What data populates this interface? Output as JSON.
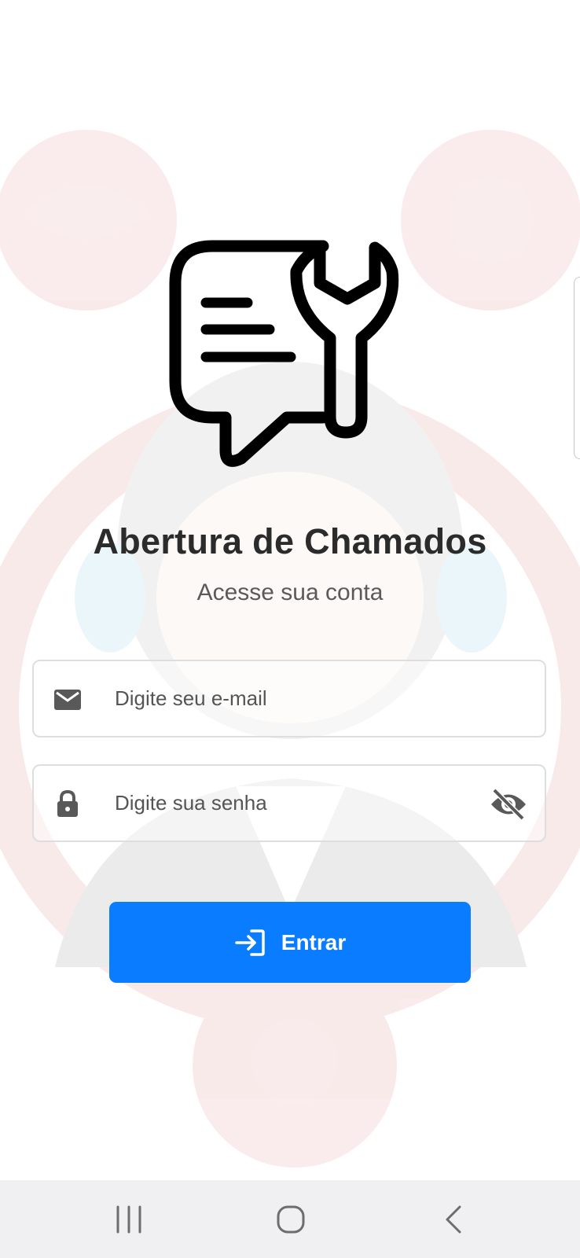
{
  "app": {
    "title": "Abertura de Chamados",
    "subtitle": "Acesse sua conta"
  },
  "form": {
    "email": {
      "placeholder": "Digite seu e-mail",
      "icon": "mail-icon",
      "value": ""
    },
    "password": {
      "placeholder": "Digite sua senha",
      "icon": "lock-icon",
      "toggle_icon": "eye-off-icon",
      "value": ""
    },
    "submit": {
      "label": "Entrar",
      "icon": "login-icon"
    }
  },
  "navbar": {
    "items": [
      "recent-apps",
      "home",
      "back"
    ]
  },
  "colors": {
    "primary": "#0a7cff",
    "title": "#2b2b2b",
    "subtitle": "#5a5a5a",
    "field_border": "#dedede",
    "background_art": "#c62828"
  }
}
